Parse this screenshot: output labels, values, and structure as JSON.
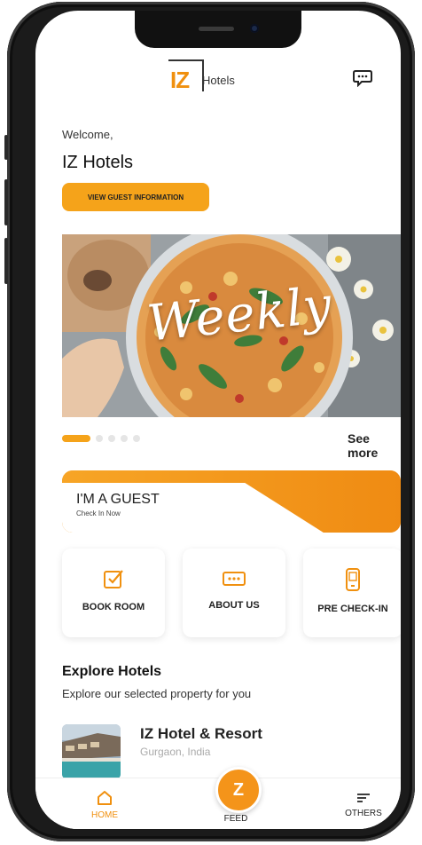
{
  "brand": {
    "logo_mark": "IZ",
    "logo_text": "Hotels"
  },
  "header": {
    "chat_icon": "chat-bubble-icon"
  },
  "welcome": {
    "greeting": "Welcome,",
    "name": "IZ Hotels",
    "button_label": "VIEW GUEST INFORMATION"
  },
  "banner": {
    "title": "Weekly",
    "slide_index": 1,
    "slide_count": 5,
    "see_more_label": "See more"
  },
  "guest_card": {
    "title": "I'M A GUEST",
    "subtitle": "Check In Now"
  },
  "tiles": [
    {
      "label": "BOOK ROOM",
      "icon": "checkbox-icon"
    },
    {
      "label": "ABOUT US",
      "icon": "card-icon"
    },
    {
      "label": "PRE CHECK-IN",
      "icon": "phone-icon"
    }
  ],
  "explore": {
    "title": "Explore Hotels",
    "subtitle": "Explore our selected property for you",
    "hotels": [
      {
        "name": "IZ Hotel & Resort",
        "location": "Gurgaon, India"
      }
    ]
  },
  "nav": {
    "home_label": "HOME",
    "feed_label": "FEED",
    "others_label": "OTHERS",
    "fab_label": "Z"
  },
  "colors": {
    "accent": "#f5a31a",
    "accent_dark": "#ef8a12",
    "text": "#222222"
  }
}
